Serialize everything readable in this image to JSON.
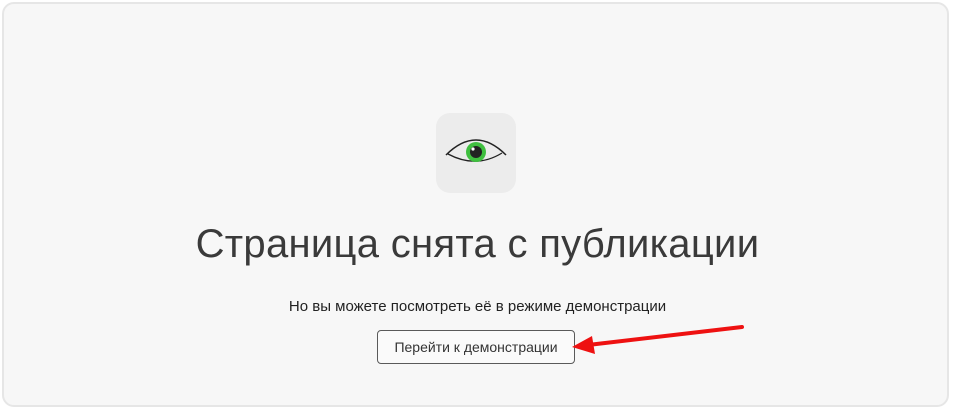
{
  "page": {
    "title": "Страница снята с публикации",
    "subtitle": "Но вы можете посмотреть её в режиме демонстрации",
    "demo_button_label": "Перейти к демонстрации"
  },
  "icons": {
    "logo": "eye-icon",
    "annotation": "red-arrow-icon"
  },
  "colors": {
    "iris": "#3fbf3f",
    "pupil": "#222222",
    "annotation_arrow": "#ee1111"
  }
}
